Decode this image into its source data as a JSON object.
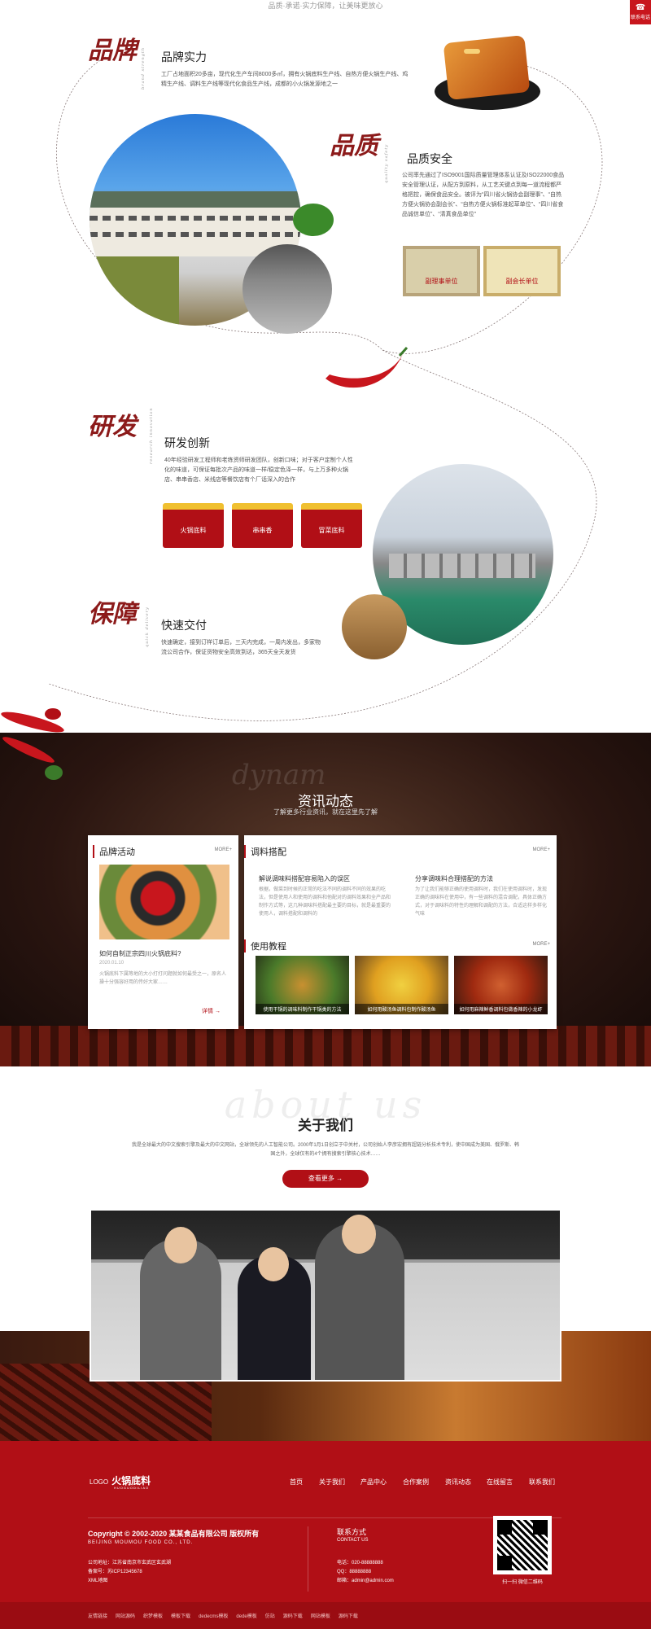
{
  "top": {
    "tagline": "品质·承诺·实力保障，让美味更放心",
    "contact_badge": "联系电话"
  },
  "features": [
    {
      "calligraphy": "品牌",
      "en": "brand strength",
      "title": "品牌实力",
      "text": "工厂占地面积20多亩，现代化生产车间8000多㎡，拥有火锅底料生产线、自热方便火锅生产线、鸡精生产线、调料生产线等现代化食品生产线，成都的小火锅发源地之一"
    },
    {
      "calligraphy": "品质",
      "en": "quality safety",
      "title": "品质安全",
      "text": "公司率先通过了ISO9001国际质量管理体系认证及ISO22000食品安全管理认证，从配方到原料，从工艺关键点到每一道流程都严格把控，确保食品安全。被评为“四川省火锅协会副理事”、“自热方便火锅协会副会长”、“自热方便火锅标准起草单位”、“四川省食品诚信单位”、“清真食品单位”"
    },
    {
      "calligraphy": "研发",
      "en": "research innovation",
      "title": "研发创新",
      "text": "40年经验研发工程师和老练资师研发团队，创新口味；对于客户定制个人性化的味道，可保证每批次产品的味道一样/稳定色泽一样，与上万多种火锅店、串串香店、米线店等餐饮店有个厂话深入的合作"
    },
    {
      "calligraphy": "保障",
      "en": "quick delivery",
      "title": "快速交付",
      "text": "快速确定，接到订样订单后，三天内完成，一周内发出，多家物流公司合作，保证货物安全高效到达，365天全天发货"
    }
  ],
  "certificates": [
    "副理事单位",
    "副会长单位"
  ],
  "products": [
    "火锅底料",
    "串串香",
    "冒菜底料"
  ],
  "news": {
    "title": "资讯动态",
    "subtitle": "了解更多行业资讯，就在这里先了解",
    "watermark": "dynam",
    "card1": {
      "heading": "品牌活动",
      "more": "MORE+",
      "item_title": "如何自制正宗四川火锅底料?",
      "date": "2020.01.10",
      "text": "火锅底料下属等地的大小打打问题就如何最受之一，原名人操十分强容好用的传好大家……",
      "detail": "详情"
    },
    "card2": {
      "heading": "调料搭配",
      "more": "MORE+",
      "items": [
        {
          "title": "解说调味料搭配容易陷入的误区",
          "text": "根据，做菜到时候的正常的吃法不同的调料不同的效果的吃法，但是使用人和使用的调料和他配对的调料效果和全产品和制作方式等，这几种调味料搭配最主要的目标，就是最重要的使用人，调料搭配和调料的"
        },
        {
          "title": "分享调味料合理搭配的方法",
          "text": "为了让我们能够正确的使用调料时，我们在使用调料时，发现正确的调味料在使用中，有一些调料的混合调配，具体正确方式，对于调味料的特性的理解和调配的方法，合适这样多样化气味"
        }
      ]
    },
    "card3": {
      "heading": "使用教程",
      "more": "MORE+",
      "items": [
        {
          "caption": "使用干锅的调味料制作干锅类的方法"
        },
        {
          "caption": "如何用酸汤鱼调料包制作酸汤鱼"
        },
        {
          "caption": "如何用麻辣鲜香调料包做香辣的小龙虾"
        }
      ]
    }
  },
  "about": {
    "en_watermark": "about us",
    "title": "关于我们",
    "text": "我是全球最大的中文搜索引擎及最大的中文网站，全球领先的人工智能公司。2000年1月1日创立于中关村，公司创始人李彦宏拥有超链分析技术专利，使中国成为美国、俄罗斯、韩国之外，全球仅有的4个拥有搜索引擎核心技术……",
    "button": "查看更多"
  },
  "footer": {
    "logo": "火锅底料",
    "logo_prefix": "LOGO",
    "logo_en": "HUOGUODILIAO",
    "nav": [
      "首页",
      "关于我们",
      "产品中心",
      "合作案例",
      "资讯动态",
      "在线留言",
      "联系我们"
    ],
    "copyright": "Copyright © 2002-2020 某某食品有限公司 版权所有",
    "company_en": "BEIJING MOUMOU FOOD CO., LTD.",
    "address": "公司地址：江苏省南京市玄武区玄武湖",
    "icp": "备案号：苏ICP12345678",
    "sitemap": "XML地图",
    "contact_title": "联系方式",
    "contact_en": "CONTACT US",
    "phone": "电话：020-88888888",
    "qq": "QQ：88888888",
    "email": "邮箱：admin@admin.com",
    "qr_caption": "扫一扫 微信二维码",
    "links": [
      "友情链接",
      "网站源码",
      "织梦模板",
      "模板下载",
      "dedecms模板",
      "dede模板",
      "仿站",
      "源码下载",
      "网站模板",
      "源码下载"
    ]
  }
}
